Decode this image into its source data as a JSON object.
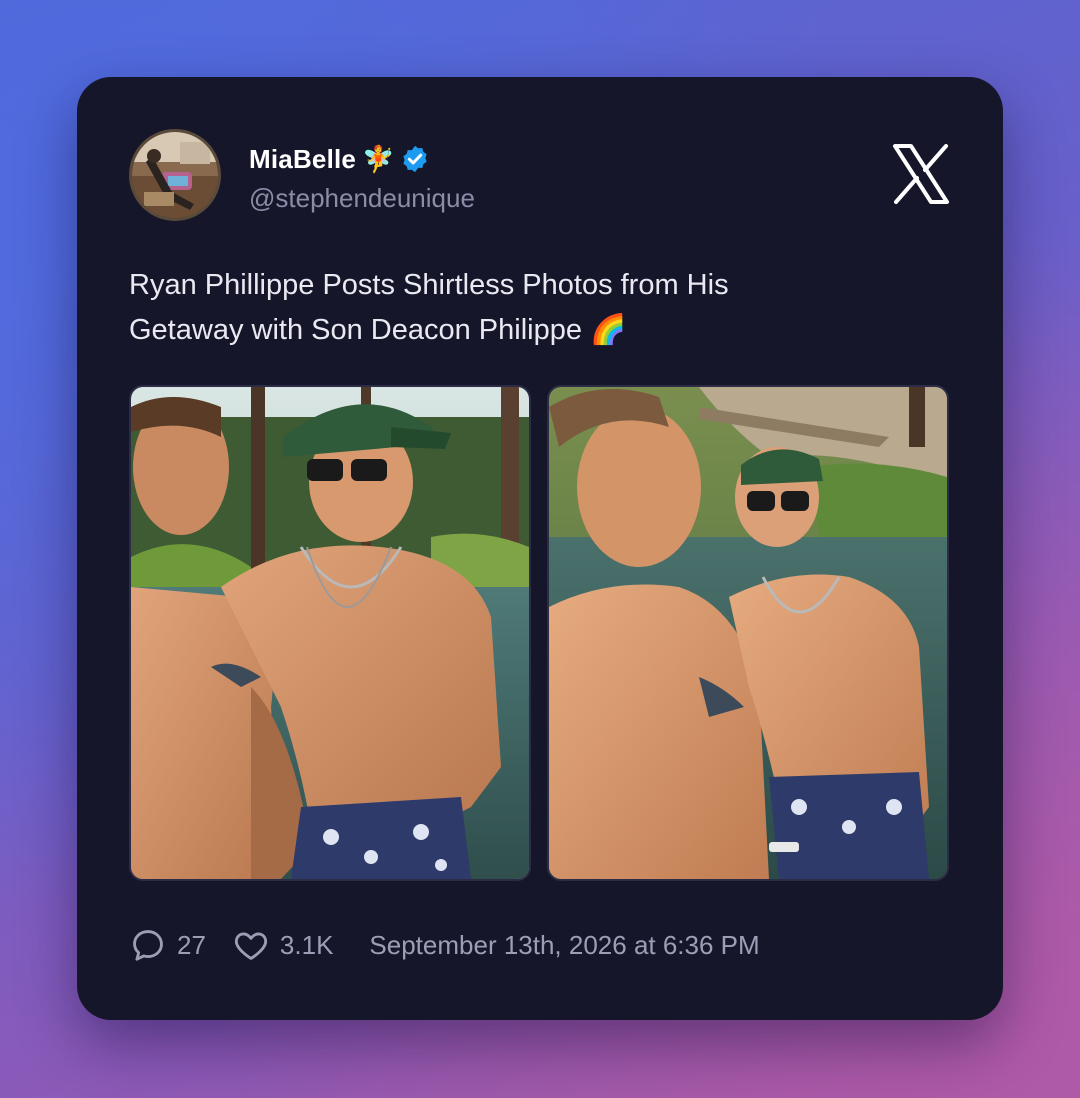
{
  "author": {
    "display_name": "MiaBelle",
    "name_emoji": "🧚",
    "handle": "@stephendeunique",
    "verified": true,
    "verified_color": "#1d9bf0"
  },
  "tweet": {
    "text_line1": "Ryan Phillippe Posts Shirtless Photos from His",
    "text_line2": "Getaway with Son Deacon Philippe 🌈"
  },
  "photos": [
    {
      "icon": "photo-forest-lake-two-men"
    },
    {
      "icon": "photo-creek-two-men-la-cap"
    }
  ],
  "footer": {
    "reply_count": "27",
    "like_count": "3.1K",
    "timestamp": "September 13th, 2026 at 6:36 PM"
  },
  "colors": {
    "card_background": "#16162b",
    "text_primary": "#ffffff",
    "text_secondary": "#8b8ca6",
    "background_gradient_start": "#5267d6",
    "background_gradient_end": "#a3589f"
  }
}
